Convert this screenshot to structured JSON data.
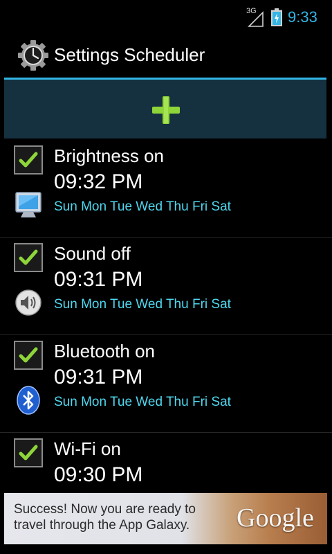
{
  "status_bar": {
    "network": "3G",
    "time": "9:33"
  },
  "app_bar": {
    "title": "Settings Scheduler"
  },
  "add_button": {
    "icon": "plus-icon"
  },
  "schedules": [
    {
      "title": "Brightness on",
      "time": "09:32 PM",
      "days": "Sun Mon Tue Wed Thu Fri Sat",
      "icon": "monitor-icon",
      "enabled": true
    },
    {
      "title": "Sound off",
      "time": "09:31 PM",
      "days": "Sun Mon Tue Wed Thu Fri Sat",
      "icon": "speaker-icon",
      "enabled": true
    },
    {
      "title": "Bluetooth on",
      "time": "09:31 PM",
      "days": "Sun Mon Tue Wed Thu Fri Sat",
      "icon": "bluetooth-icon",
      "enabled": true
    },
    {
      "title": "Wi-Fi on",
      "time": "09:30 PM",
      "days": "",
      "icon": "wifi-icon",
      "enabled": true
    }
  ],
  "ad": {
    "line1": "Success! Now you are ready to",
    "line2": "travel through the App Galaxy.",
    "logo": "Google"
  },
  "colors": {
    "accent": "#33b5e5",
    "days": "#4fd8f0",
    "check": "#8ed53a",
    "add_bar": "#15303f"
  }
}
